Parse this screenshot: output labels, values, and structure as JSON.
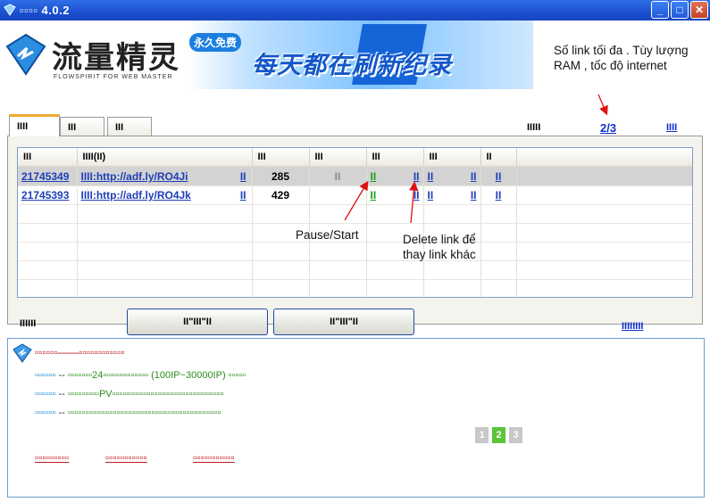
{
  "window": {
    "title": "▫▫▫▫ 4.0.2",
    "minimize": "_",
    "maximize": "□",
    "close": "✕"
  },
  "banner": {
    "brand": "流量精灵",
    "brand_en": "FLOWSPIRIT FOR WEB MASTER",
    "free_badge": "永久免费",
    "slogan": "每天都在刷新纪录"
  },
  "annotations": {
    "max_links": "Số link tối đa . Tùy lượng RAM , tốc độ internet",
    "pause_start": "Pause/Start",
    "delete_link": "Delete link để thay link khác"
  },
  "tabs": [
    "IIII",
    "III",
    "III"
  ],
  "status": {
    "label": "IIIII",
    "count": "2/3",
    "link": "IIII"
  },
  "table": {
    "headers": [
      "III",
      "IIII(II)",
      "III",
      "III",
      "III",
      "III",
      "II"
    ],
    "rows": [
      {
        "id": "21745349",
        "url": "IIII:http://adf.ly/RO4Ji",
        "edit": "II",
        "value": "285",
        "state": "II",
        "play": "II",
        "del": "II",
        "c1": "II",
        "c2": "II",
        "c3": "II"
      },
      {
        "id": "21745393",
        "url": "IIII:http://adf.ly/RO4Jk",
        "edit": "II",
        "value": "429",
        "state": "",
        "play": "II",
        "del": "II",
        "c1": "II",
        "c2": "II",
        "c3": "II"
      }
    ]
  },
  "footer": {
    "label": "IIIIII",
    "button1": "II\"III\"II",
    "button2": "II\"III\"II",
    "link": "IIIIIIII"
  },
  "info": {
    "title": "▫▫▫▫▫▫——▫▫▫▫▫▫▫▫▫▫▫▫",
    "tips": [
      {
        "key": "▫▫▫▫▫▫",
        "sep": "--",
        "text": "▫▫▫▫▫▫▫24▫▫▫▫▫▫▫▫▫▫▫▫▫ (100IP~30000IP) ▫▫▫▫▫"
      },
      {
        "key": "▫▫▫▫▫▫",
        "sep": "--",
        "text": "▫▫▫▫▫▫▫▫▫PV▫▫▫▫▫▫▫▫▫▫▫▫▫▫▫▫▫▫▫▫▫▫▫▫▫▫▫▫▫▫▫▫"
      },
      {
        "key": "▫▫▫▫▫▫",
        "sep": "--",
        "text": "▫▫▫▫▫▫▫▫▫▫▫▫▫▫▫▫▫▫▫▫▫▫▫▫▫▫▫▫▫▫▫▫▫▫▫▫▫▫▫▫▫▫▫▫"
      }
    ],
    "pages": [
      "1",
      "2",
      "3"
    ],
    "links": [
      "▫▫▫▫▫▫▫▫▫",
      "▫▫▫▫▫▫▫▫▫▫▫",
      "▫▫▫▫▫▫▫▫▫▫▫"
    ]
  },
  "colors": {
    "titlebar": "#1a4fd0",
    "accent_red": "#c0181c",
    "link_blue": "#1d3fb8",
    "active_page": "#5ac43a",
    "inactive_page": "#c8c8c8"
  }
}
